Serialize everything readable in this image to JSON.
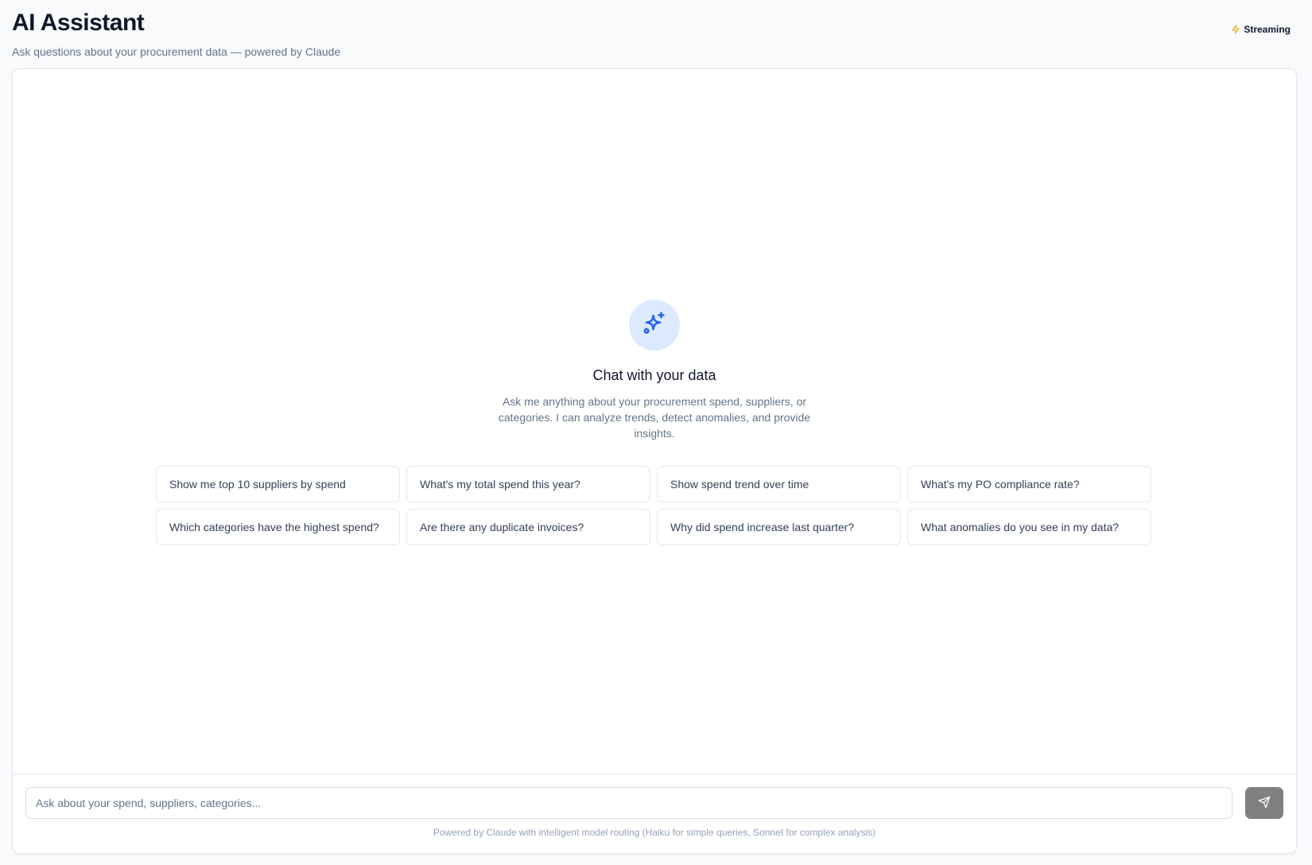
{
  "header": {
    "title": "AI Assistant",
    "subtitle": "Ask questions about your procurement data — powered by Claude",
    "status_label": "Streaming",
    "status_icon": "lightning-icon"
  },
  "empty_state": {
    "icon": "sparkles-icon",
    "title": "Chat with your data",
    "description": "Ask me anything about your procurement spend, suppliers, or categories. I can analyze trends, detect anomalies, and provide insights."
  },
  "suggestions": [
    "Show me top 10 suppliers by spend",
    "What's my total spend this year?",
    "Show spend trend over time",
    "What's my PO compliance rate?",
    "Which categories have the highest spend?",
    "Are there any duplicate invoices?",
    "Why did spend increase last quarter?",
    "What anomalies do you see in my data?"
  ],
  "composer": {
    "placeholder": "Ask about your spend, suppliers, categories...",
    "value": "",
    "send_icon": "send-icon",
    "footnote": "Powered by Claude with intelligent model routing (Haiku for simple queries, Sonnet for complex analysis)"
  },
  "colors": {
    "accent": "#2563eb",
    "accent_soft": "#dbeafe",
    "streaming_icon": "#eab308",
    "send_button": "#808080"
  }
}
